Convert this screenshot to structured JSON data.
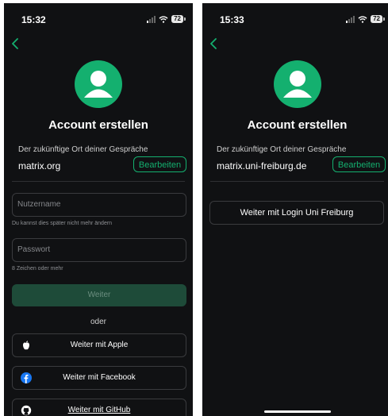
{
  "colors": {
    "accent": "#14b06f",
    "background": "#101113"
  },
  "left": {
    "status_time": "15:32",
    "battery": "72",
    "title": "Account erstellen",
    "homeserver_label": "Der zukünftige Ort deiner Gespräche",
    "homeserver_value": "matrix.org",
    "edit_label": "Bearbeiten",
    "username_placeholder": "Nutzername",
    "username_hint": "Du kannst dies später nicht mehr ändern",
    "password_placeholder": "Passwort",
    "password_hint": "8 Zeichen oder mehr",
    "continue_label": "Weiter",
    "or_label": "oder",
    "apple_label": "Weiter mit Apple",
    "facebook_label": "Weiter mit Facebook",
    "github_label": "Weiter mit GitHub"
  },
  "right": {
    "status_time": "15:33",
    "battery": "72",
    "title": "Account erstellen",
    "homeserver_label": "Der zukünftige Ort deiner Gespräche",
    "homeserver_value": "matrix.uni-freiburg.de",
    "edit_label": "Bearbeiten",
    "sso_label": "Weiter mit Login Uni Freiburg"
  }
}
